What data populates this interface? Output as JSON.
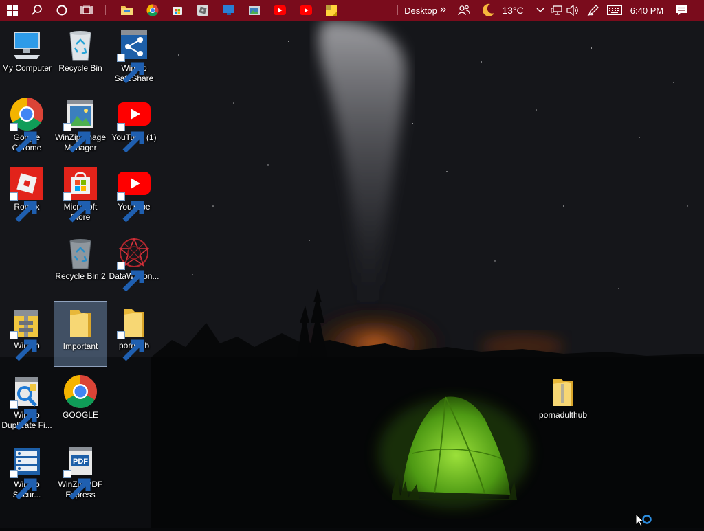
{
  "taskbar": {
    "desktop_label": "Desktop",
    "weather_temp": "13°C",
    "time": "6:40 PM"
  },
  "desktop": {
    "icons": [
      {
        "label": "My Computer"
      },
      {
        "label": "Recycle Bin"
      },
      {
        "label": "WinZip SafeShare"
      },
      {
        "label": "Google Chrome"
      },
      {
        "label": "WinZip Image Manager"
      },
      {
        "label": "YouTube (1)"
      },
      {
        "label": "Roblox"
      },
      {
        "label": "Microsoft Store"
      },
      {
        "label": "YouTube"
      },
      {
        "label": "Recycle Bin 2"
      },
      {
        "label": "DataWagon..."
      },
      {
        "label": "WinZip"
      },
      {
        "label": "Important"
      },
      {
        "label": "pornhub"
      },
      {
        "label": "WinZip Duplicate Fi..."
      },
      {
        "label": "GOOGLE"
      },
      {
        "label": "WinZip Secur..."
      },
      {
        "label": "WinZip PDF Express"
      },
      {
        "label": "pornadulthub"
      }
    ]
  },
  "colors": {
    "taskbar": "#7a0c1c",
    "selection": "#7896be",
    "tent": "#7ccd2c"
  }
}
